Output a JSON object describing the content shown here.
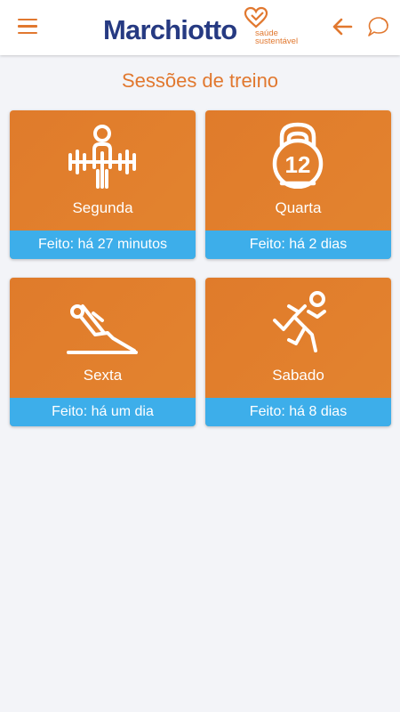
{
  "colors": {
    "accent": "#e1782f",
    "brand": "#263a82",
    "card": "#e07b2b",
    "status": "#3daeea",
    "background": "#f3f4f8"
  },
  "header": {
    "menu_icon": "hamburger-menu-icon",
    "logo": {
      "name": "Marchiotto",
      "tagline_1": "saúde",
      "tagline_2": "sustentável"
    },
    "back_icon": "arrow-left-icon",
    "chat_icon": "chat-bubble-icon"
  },
  "page": {
    "title": "Sessões de treino"
  },
  "sessions": [
    {
      "day": "Segunda",
      "status": "Feito: há 27 minutos",
      "icon": "weightlifter-icon"
    },
    {
      "day": "Quarta",
      "status": "Feito: há 2 dias",
      "icon": "kettlebell-12-icon",
      "icon_text": "12"
    },
    {
      "day": "Sexta",
      "status": "Feito: há um dia",
      "icon": "stretching-icon"
    },
    {
      "day": "Sabado",
      "status": "Feito: há 8 dias",
      "icon": "runner-icon"
    }
  ]
}
